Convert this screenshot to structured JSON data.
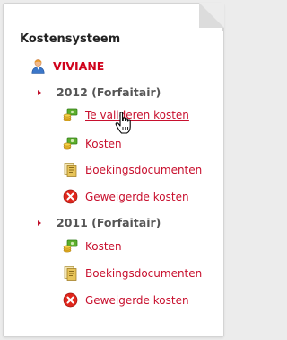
{
  "panel": {
    "title": "Kostensysteem",
    "user": {
      "name": "VIVIANE",
      "icon": "user-icon"
    }
  },
  "years": [
    {
      "label": "2012 (Forfaitair)",
      "items": [
        {
          "label": "Te valideren kosten",
          "icon": "money-icon"
        },
        {
          "label": "Kosten",
          "icon": "money-icon"
        },
        {
          "label": "Boekingsdocumenten",
          "icon": "documents-icon"
        },
        {
          "label": "Geweigerde kosten",
          "icon": "reject-icon"
        }
      ]
    },
    {
      "label": "2011 (Forfaitair)",
      "items": [
        {
          "label": "Kosten",
          "icon": "money-icon"
        },
        {
          "label": "Boekingsdocumenten",
          "icon": "documents-icon"
        },
        {
          "label": "Geweigerde kosten",
          "icon": "reject-icon"
        }
      ]
    }
  ],
  "colors": {
    "link": "#c8102e",
    "user": "#d0021b",
    "year": "#555555",
    "title": "#222222"
  }
}
